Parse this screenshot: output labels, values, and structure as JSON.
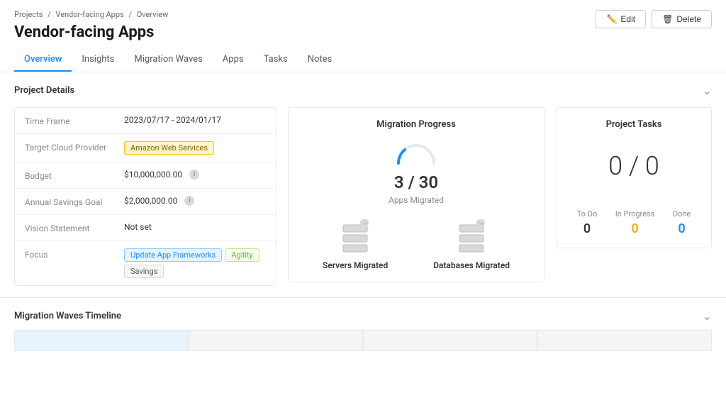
{
  "breadcrumb": {
    "items": [
      "Projects",
      "Vendor-facing Apps",
      "Overview"
    ],
    "separators": [
      "/",
      "/"
    ]
  },
  "page": {
    "title": "Vendor-facing Apps"
  },
  "header_buttons": {
    "edit_label": "Edit",
    "delete_label": "Delete"
  },
  "tabs": [
    {
      "id": "overview",
      "label": "Overview",
      "active": true
    },
    {
      "id": "insights",
      "label": "Insights",
      "active": false
    },
    {
      "id": "migration-waves",
      "label": "Migration Waves",
      "active": false
    },
    {
      "id": "apps",
      "label": "Apps",
      "active": false
    },
    {
      "id": "tasks",
      "label": "Tasks",
      "active": false
    },
    {
      "id": "notes",
      "label": "Notes",
      "active": false
    }
  ],
  "project_details": {
    "section_title": "Project Details",
    "rows": [
      {
        "label": "Time Frame",
        "value": "2023/07/17 - 2024/01/17",
        "type": "text"
      },
      {
        "label": "Target Cloud Provider",
        "value": "Amazon Web Services",
        "type": "badge-aws"
      },
      {
        "label": "Budget",
        "value": "$10,000,000.00",
        "type": "text-info"
      },
      {
        "label": "Annual Savings Goal",
        "value": "$2,000,000.00",
        "type": "text-info"
      },
      {
        "label": "Vision Statement",
        "value": "Not set",
        "type": "text"
      },
      {
        "label": "Focus",
        "values": [
          "Update App Frameworks",
          "Agility",
          "Savings"
        ],
        "type": "badges-multi"
      }
    ]
  },
  "migration_progress": {
    "card_title": "Migration Progress",
    "apps_current": "3",
    "apps_total": "30",
    "apps_separator": "/",
    "apps_label": "Apps Migrated",
    "servers_label": "Servers Migrated",
    "databases_label": "Databases Migrated"
  },
  "project_tasks": {
    "card_title": "Project Tasks",
    "main_value": "0 / 0",
    "todo_label": "To Do",
    "todo_value": "0",
    "inprogress_label": "In Progress",
    "inprogress_value": "0",
    "done_label": "Done",
    "done_value": "0"
  },
  "migration_waves": {
    "section_title": "Migration Waves Timeline"
  },
  "colors": {
    "accent": "#1890ff",
    "warning": "#faad14",
    "success": "#52c41a",
    "gray": "#888"
  }
}
